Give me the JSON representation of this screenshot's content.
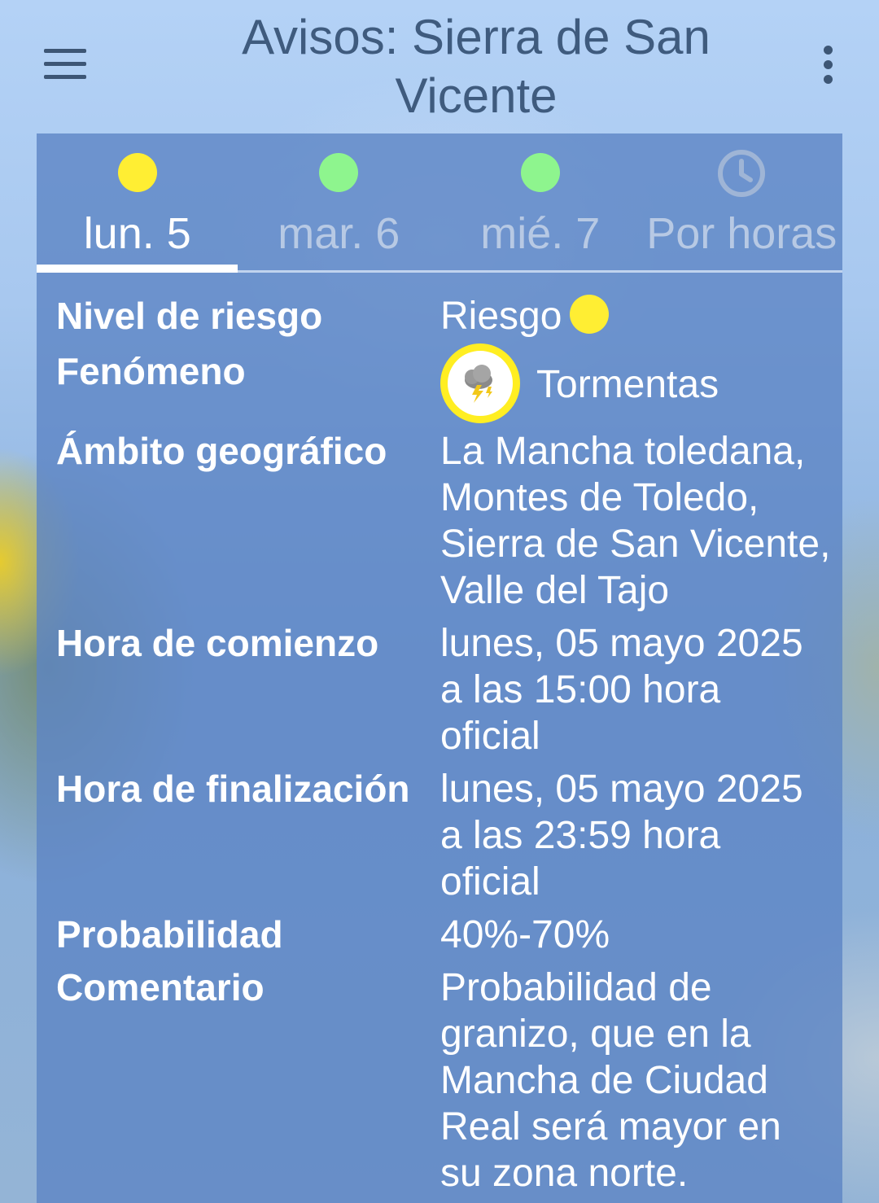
{
  "app_bar": {
    "title": "Avisos: Sierra de San Vicente",
    "menu_icon": "hamburger-menu-icon",
    "overflow_icon": "more-vertical-icon"
  },
  "tabs": [
    {
      "label": "lun. 5",
      "indicator": "yellow",
      "indicator_color": "#ffee33",
      "active": true
    },
    {
      "label": "mar. 6",
      "indicator": "green",
      "indicator_color": "#8ef58e",
      "active": false
    },
    {
      "label": "mié. 7",
      "indicator": "green",
      "indicator_color": "#8ef58e",
      "active": false
    },
    {
      "label": "Por horas",
      "indicator": "clock-icon",
      "active": false
    }
  ],
  "details": {
    "risk_level": {
      "label": "Nivel de riesgo",
      "value": "Riesgo",
      "color": "#ffee33"
    },
    "phenomenon": {
      "label": "Fenómeno",
      "value": "Tormentas",
      "icon": "thunderstorm-icon"
    },
    "geo_scope": {
      "label": "Ámbito geográfico",
      "value": "La Mancha toledana, Montes de Toledo, Sierra de San Vicente, Valle del Tajo"
    },
    "start_time": {
      "label": "Hora de comienzo",
      "value": "lunes, 05 mayo 2025 a las 15:00 hora oficial"
    },
    "end_time": {
      "label": "Hora de finalización",
      "value": "lunes, 05 mayo 2025 a las 23:59 hora oficial"
    },
    "probability": {
      "label": "Probabilidad",
      "value": "40%-70%"
    },
    "comment": {
      "label": "Comentario",
      "value": "Probabilidad de granizo, que en la Mancha de Ciudad Real será mayor en su zona norte."
    }
  }
}
